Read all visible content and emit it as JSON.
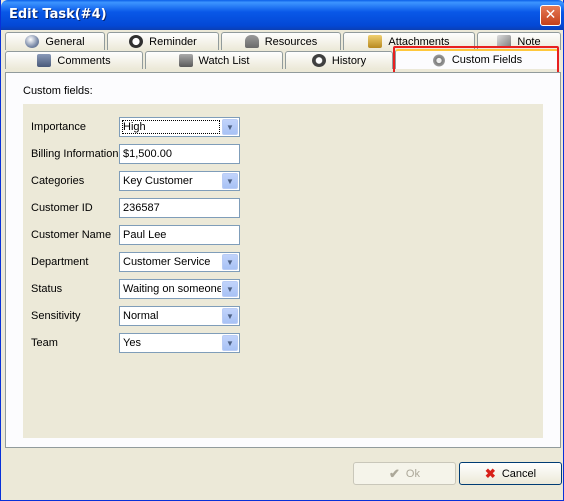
{
  "window": {
    "title": "Edit Task(#4)",
    "close_glyph": "✕"
  },
  "tabs": {
    "row1": [
      {
        "label": "General",
        "icon": "globe-icon",
        "color": "#6a7a9a"
      },
      {
        "label": "Reminder",
        "icon": "alarm-clock-icon",
        "color": "#404040"
      },
      {
        "label": "Resources",
        "icon": "people-icon",
        "color": "#7a7a7a"
      },
      {
        "label": "Attachments",
        "icon": "lock-icon",
        "color": "#c8a23a"
      },
      {
        "label": "Note",
        "icon": "pencil-icon",
        "color": "#7a7a7a"
      }
    ],
    "row2": [
      {
        "label": "Comments",
        "icon": "comments-icon",
        "color": "#5a6a8a"
      },
      {
        "label": "Watch List",
        "icon": "watch-list-icon",
        "color": "#6a6a6a"
      },
      {
        "label": "History",
        "icon": "history-icon",
        "color": "#505050"
      },
      {
        "label": "Custom Fields",
        "icon": "gear-icon",
        "color": "#7a7a7a",
        "active": true
      }
    ]
  },
  "custom_fields": {
    "section_label": "Custom fields:",
    "fields": [
      {
        "label": "Importance",
        "value": "High",
        "type": "combo"
      },
      {
        "label": "Billing Information",
        "value": "$1,500.00",
        "type": "text"
      },
      {
        "label": "Categories",
        "value": "Key Customer",
        "type": "combo"
      },
      {
        "label": "Customer ID",
        "value": "236587",
        "type": "text"
      },
      {
        "label": "Customer Name",
        "value": "Paul Lee",
        "type": "text"
      },
      {
        "label": "Department",
        "value": "Customer Service",
        "type": "combo"
      },
      {
        "label": "Status",
        "value": "Waiting on someone",
        "type": "combo"
      },
      {
        "label": "Sensitivity",
        "value": "Normal",
        "type": "combo"
      },
      {
        "label": "Team",
        "value": "Yes",
        "type": "combo"
      }
    ]
  },
  "buttons": {
    "ok": {
      "label": "Ok",
      "glyph": "✔",
      "enabled": false
    },
    "cancel": {
      "label": "Cancel",
      "glyph": "✖",
      "color": "#d8201a"
    }
  },
  "dropdown_glyph": "▼"
}
